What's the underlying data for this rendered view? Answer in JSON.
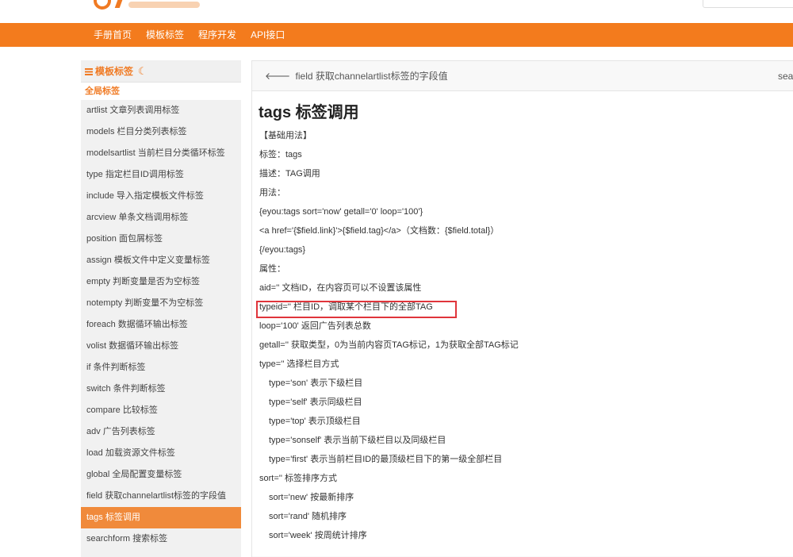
{
  "nav": {
    "items": [
      "手册首页",
      "模板标签",
      "程序开发",
      "API接口"
    ]
  },
  "sidebar": {
    "header": "模板标签",
    "group": "全局标签",
    "items": [
      "artlist 文章列表调用标签",
      "models 栏目分类列表标签",
      "modelsartlist 当前栏目分类循环标签",
      "type 指定栏目ID调用标签",
      "include 导入指定模板文件标签",
      "arcview 单条文档调用标签",
      "position 面包屑标签",
      "assign 模板文件中定义变量标签",
      "empty 判断变量是否为空标签",
      "notempty 判断变量不为空标签",
      "foreach 数据循环输出标签",
      "volist 数据循环输出标签",
      "if 条件判断标签",
      "switch 条件判断标签",
      "compare 比较标签",
      "adv 广告列表标签",
      "load 加载资源文件标签",
      "global 全局配置变量标签",
      "field 获取channelartlist标签的字段值",
      "tags 标签调用",
      "searchform 搜索标签"
    ],
    "active_index": 19
  },
  "content": {
    "prev_link": "field 获取channelartlist标签的字段值",
    "search_hint": "sear",
    "title": "tags 标签调用",
    "lines": [
      "【基础用法】",
      "标签：tags",
      "描述：TAG调用",
      "用法：",
      "{eyou:tags sort='now' getall='0' loop='100'}",
      "<a href='{$field.link}'>{$field.tag}</a>（文档数：{$field.total}）",
      "{/eyou:tags}",
      "属性：",
      "aid='' 文档ID，在内容页可以不设置该属性",
      "typeid='' 栏目ID，调取某个栏目下的全部TAG",
      "loop='100' 返回广告列表总数",
      "getall='' 获取类型，0为当前内容页TAG标记，1为获取全部TAG标记",
      "type='' 选择栏目方式",
      "type='son' 表示下级栏目",
      "type='self' 表示同级栏目",
      "type='top' 表示顶级栏目",
      "type='sonself' 表示当前下级栏目以及同级栏目",
      "type='first' 表示当前栏目ID的最顶级栏目下的第一级全部栏目",
      "sort='' 标签排序方式",
      "sort='new' 按最新排序",
      "sort='rand' 随机排序",
      "sort='week' 按周统计排序"
    ],
    "highlighted_line_index": 9
  },
  "colors": {
    "brand": "#f37b1d",
    "active": "#f08a3b",
    "highlight_border": "#e0353b"
  }
}
